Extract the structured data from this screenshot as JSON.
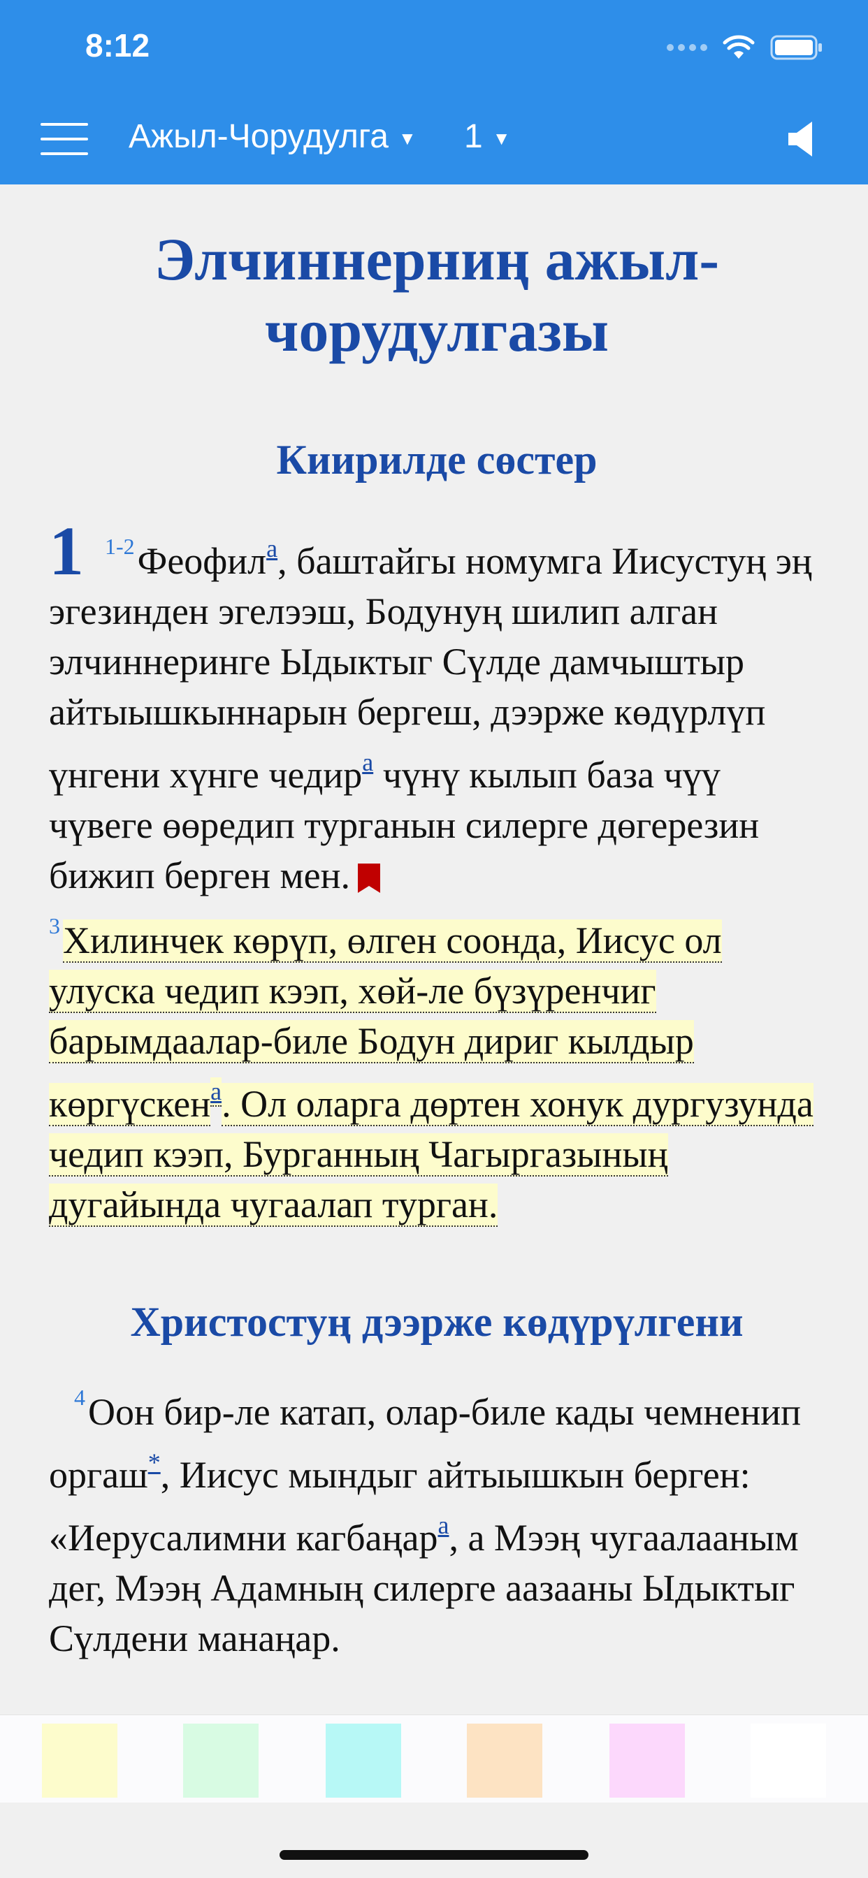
{
  "status_bar": {
    "time": "8:12"
  },
  "toolbar": {
    "book": "Ажыл-Чорудулга",
    "chapter": "1"
  },
  "content": {
    "title": "Элчиннерниң ажыл-чорудулгазы",
    "sections": [
      {
        "heading": "Киирилде сөстер",
        "chapter_number": "1",
        "verse_1_2_num": "1-2",
        "verse_1_2_a": "Феофил",
        "verse_1_2_fn1": "a",
        "verse_1_2_b": ", баштайгы номумга Иисустуң эң эгезинден эгелээш, Бодунуң шилип алган элчиннеринге Ыдыктыг Сүлде дамчыштыр айтыышкыннарын бергеш, дээрже көдүрлүп үнгени хүнге чедир",
        "verse_1_2_fn2": "a",
        "verse_1_2_c": " чүнү кылып база чүү чүвеге өөредип турганын силерге дөгерезин бижип берген мен.",
        "verse_3_num": "3",
        "verse_3_a": "Хилинчек көрүп, өлген соонда, Иисус ол улуска чедип кээп, хөй-ле бүзүренчиг барымдаалар-биле Бодун дириг кылдыр көргүскен",
        "verse_3_fn": "a",
        "verse_3_b": ". Ол оларга дөртен хонук дургузунда чедип кээп, Бурганның Чагыргазының дугайында чугаалап турган."
      },
      {
        "heading": "Христостуң дээрже көдүрүлгени",
        "verse_4_num": "4",
        "verse_4_a": "Оон бир-ле катап, олар-биле кады чемненип оргаш",
        "verse_4_fn_star": "*",
        "verse_4_b": ", Иисус мындыг айтыышкын берген: «Иерусалимни кагбаңар",
        "verse_4_fn": "a",
        "verse_4_c": ", а Мээң чугаалааным дег, Мээң Адамның силерге аазааны Ыдыктыг Сүлдени манаңар."
      }
    ]
  },
  "highlight_palette": {
    "colors": [
      "#fdfccc",
      "#d8fbe3",
      "#b7f8f6",
      "#fde3c3",
      "#fcd8fc",
      "#ffffff"
    ]
  },
  "colors": {
    "accent": "#2e8ee9",
    "heading": "#1a4aa6",
    "bookmark": "#c00000"
  }
}
